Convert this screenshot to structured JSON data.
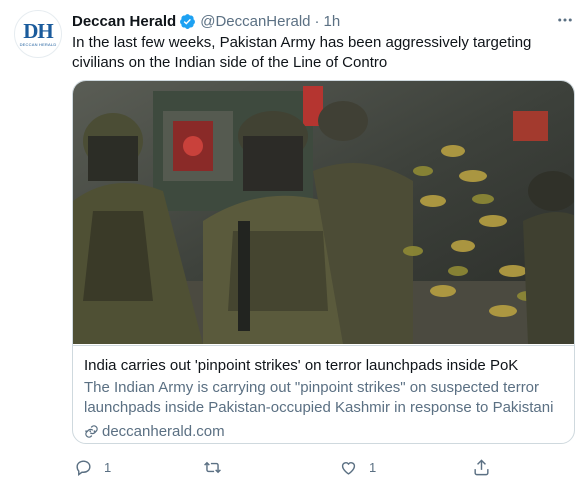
{
  "author": {
    "display_name": "Deccan Herald",
    "handle": "@DeccanHerald",
    "separator": "·",
    "time": "1h",
    "avatar_text": "DH",
    "avatar_subtext": "DECCAN HERALD",
    "verified": true
  },
  "tweet": {
    "text": "In the last few weeks, Pakistan Army has been aggressively targeting civilians on the Indian side of the Line of Contro"
  },
  "card": {
    "image_icon": "soldiers-photo",
    "title": "India carries out 'pinpoint strikes' on terror launchpads inside PoK",
    "description": "The Indian Army is carrying out \"pinpoint strikes\" on suspected terror launchpads inside Pakistan-occupied Kashmir in response to Pakistani ...",
    "domain": "deccanherald.com"
  },
  "actions": {
    "reply_count": "1",
    "retweet_count": "",
    "like_count": "1"
  },
  "icons": {
    "more": "more-icon",
    "verified": "verified-badge-icon",
    "link": "link-icon",
    "reply": "reply-icon",
    "retweet": "retweet-icon",
    "like": "heart-icon",
    "share": "share-icon"
  },
  "colors": {
    "text_primary": "#0f1419",
    "text_secondary": "#5b7083",
    "verified_blue": "#1da1f2",
    "border": "#cfd9de",
    "brand_blue": "#1a5b9c"
  }
}
